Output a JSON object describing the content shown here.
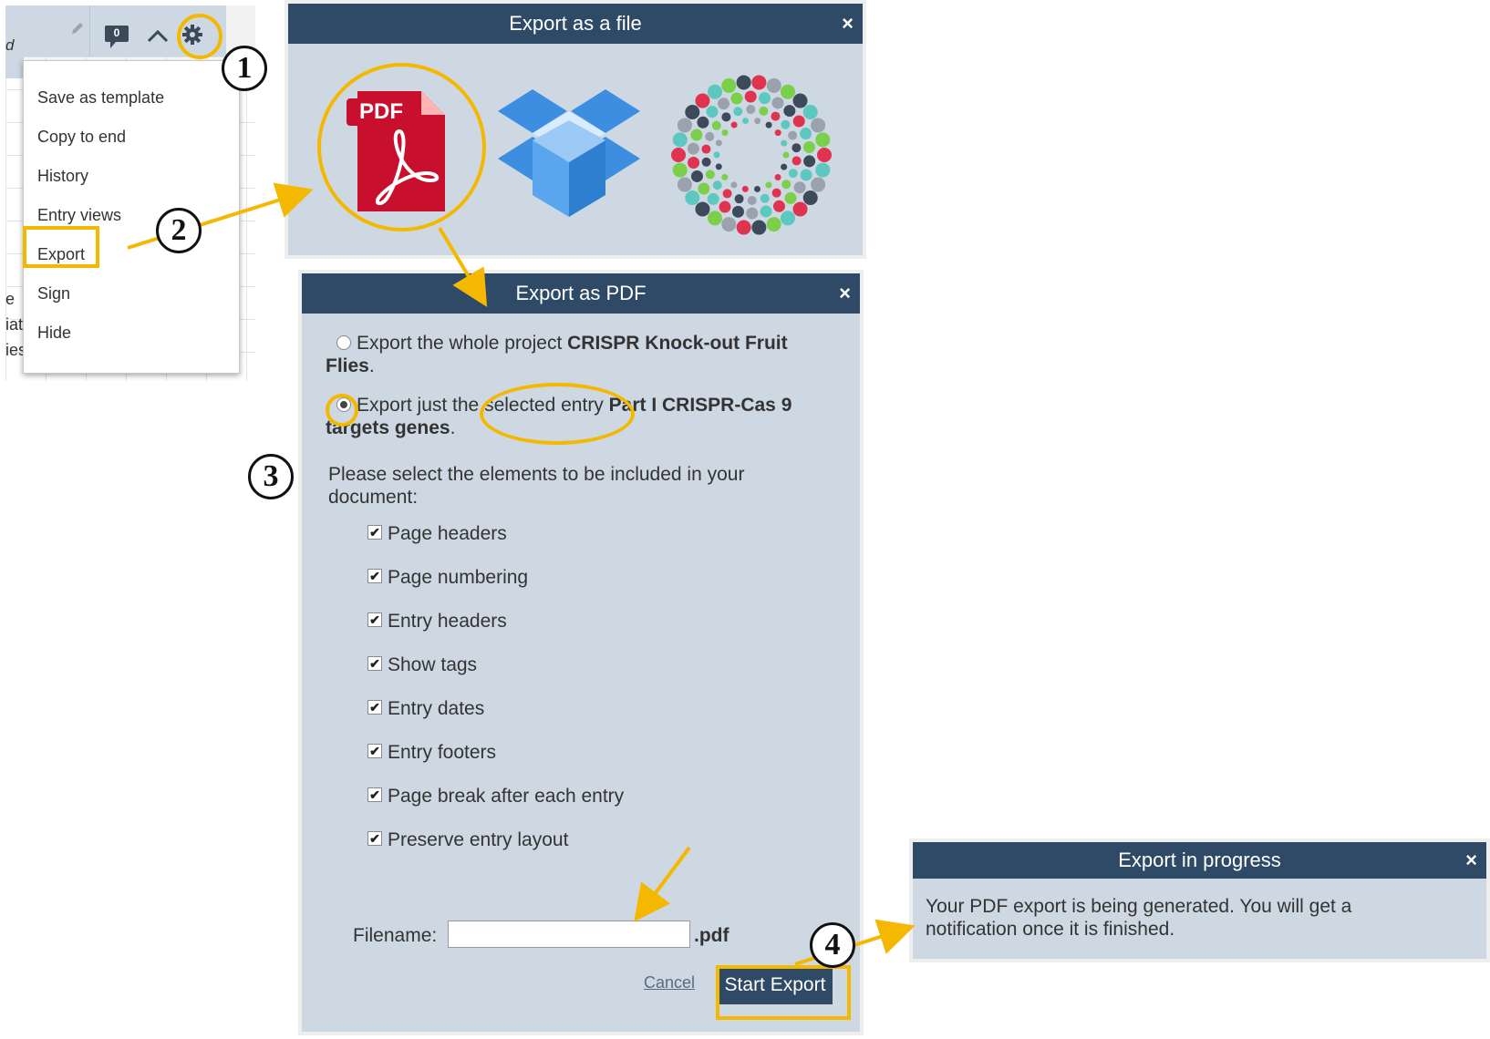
{
  "toolbar": {
    "comment_count": "0"
  },
  "gear_menu": {
    "items": [
      "Save as template",
      "Copy to end",
      "History",
      "Entry views",
      "Export",
      "Sign",
      "Hide"
    ]
  },
  "background_fragments": {
    "header": "d",
    "lines": [
      "e",
      "iat",
      "ies"
    ]
  },
  "export_file_dialog": {
    "title": "Export as a file",
    "close": "×",
    "options": {
      "pdf_badge": "PDF"
    }
  },
  "export_pdf_dialog": {
    "title": "Export as PDF",
    "close": "×",
    "radio_whole_prefix": "Export the whole project ",
    "radio_whole_project": "CRISPR Knock-out Fruit Flies",
    "radio_selected_prefix": "Export just the selected entry ",
    "radio_selected_entry": "Part I CRISPR-Cas 9 targets genes",
    "period": ".",
    "elements_prompt": "Please select the elements to be included in your document:",
    "elements": [
      {
        "label": "Page headers",
        "checked": true
      },
      {
        "label": "Page numbering",
        "checked": true
      },
      {
        "label": "Entry headers",
        "checked": true
      },
      {
        "label": "Show tags",
        "checked": true
      },
      {
        "label": "Entry dates",
        "checked": true
      },
      {
        "label": "Entry footers",
        "checked": true
      },
      {
        "label": "Page break after each entry",
        "checked": true
      },
      {
        "label": "Preserve entry layout",
        "checked": true
      }
    ],
    "filename_label": "Filename:",
    "filename_value": "",
    "filename_ext": ".pdf",
    "cancel_label": "Cancel",
    "start_label": "Start Export"
  },
  "progress_dialog": {
    "title": "Export in progress",
    "close": "×",
    "message": "Your PDF export is being generated. You will get a notification once it is finished."
  },
  "step_badges": [
    "1",
    "2",
    "3",
    "4"
  ],
  "colors": {
    "dialog_header": "#2e4a66",
    "dialog_body": "#cdd8e3",
    "highlight": "#f5b800",
    "pdf_red": "#c8102e",
    "dropbox_blue": "#3d8ee0"
  }
}
